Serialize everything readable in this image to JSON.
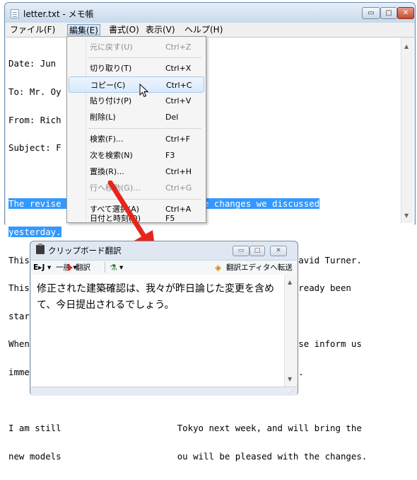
{
  "notepad": {
    "title": "letter.txt - メモ帳",
    "caption_buttons": {
      "minimize": "▭",
      "maximize": "□",
      "close": "✕"
    },
    "menubar": [
      "ファイル(F)",
      "編集(E)",
      "書式(O)",
      "表示(V)",
      "ヘルプ(H)"
    ],
    "lines": [
      "Date: Jun",
      "To: Mr. Oy",
      "From: Rich",
      "Subject: F",
      "",
      "The revise                      ng the changes we discussed",
      "yesterday.",
      "This set a                      g change requested by David Turner.",
      "This shoul                      on process which has already been",
      "started.",
      "When the r                      the City of Tokyo, please inform us",
      "immediatel                      y previous set received.",
      "",
      "I am still                      Tokyo next week, and will bring the",
      "new models                      ou will be pleased with the changes."
    ]
  },
  "edit_menu": {
    "items": [
      {
        "label": "元に戻す(U)",
        "shortcut": "Ctrl+Z",
        "disabled": true
      },
      {
        "separator": true
      },
      {
        "label": "切り取り(T)",
        "shortcut": "Ctrl+X"
      },
      {
        "label": "コピー(C)",
        "shortcut": "Ctrl+C",
        "highlighted": true
      },
      {
        "label": "貼り付け(P)",
        "shortcut": "Ctrl+V"
      },
      {
        "label": "削除(L)",
        "shortcut": "Del"
      },
      {
        "separator": true
      },
      {
        "label": "検索(F)...",
        "shortcut": "Ctrl+F"
      },
      {
        "label": "次を検索(N)",
        "shortcut": "F3"
      },
      {
        "label": "置換(R)...",
        "shortcut": "Ctrl+H"
      },
      {
        "label": "行へ移動(G)...",
        "shortcut": "Ctrl+G",
        "disabled": true
      },
      {
        "separator": true
      },
      {
        "label": "すべて選択(A)",
        "shortcut": "Ctrl+A"
      },
      {
        "label": "日付と時刻(D)",
        "shortcut": "F5"
      }
    ]
  },
  "clipboard_window": {
    "title": "クリップボード翻訳",
    "caption_buttons": {
      "minimize": "▭",
      "maximize": "□",
      "close": "✕"
    },
    "toolbar": {
      "direction": "E▸J ▾",
      "field": "一般 ▾",
      "translate": "翻訳",
      "dictionary": "▾",
      "send_to_editor": "翻訳エディタへ転送"
    },
    "result_text": "修正された建築確認は、我々が昨日論じた変更を含めて、今日提出されるでしょう。"
  },
  "colors": {
    "selection": "#3399ff",
    "arrow": "#e8241c",
    "menu_highlight": "#d9e9fb"
  }
}
